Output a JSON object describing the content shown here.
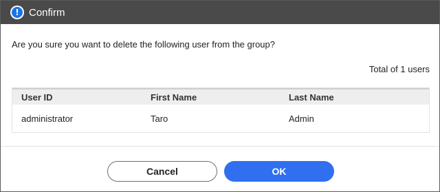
{
  "dialog": {
    "title": "Confirm",
    "icon": "info-icon",
    "message": "Are you sure you want to delete the following user from the group?",
    "total": "Total of 1 users",
    "columns": {
      "user_id": "User ID",
      "first_name": "First Name",
      "last_name": "Last Name"
    },
    "rows": [
      {
        "user_id": "administrator",
        "first_name": "Taro",
        "last_name": "Admin"
      }
    ],
    "buttons": {
      "cancel": "Cancel",
      "ok": "OK"
    }
  },
  "colors": {
    "titlebar": "#4a4a4a",
    "accent": "#2f6ff0",
    "icon": "#1a73e8"
  }
}
